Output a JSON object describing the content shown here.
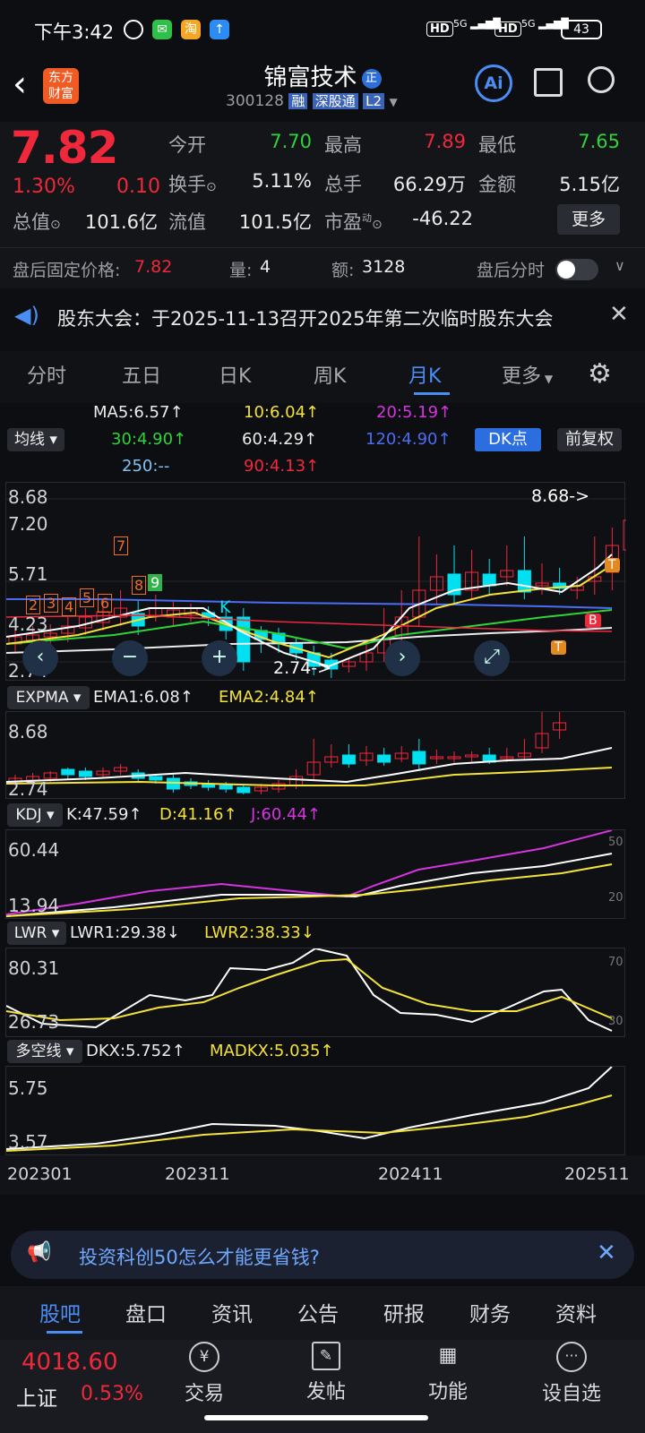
{
  "status": {
    "time": "下午3:42",
    "sig1": "HD",
    "sig2": "HD",
    "net1": "5G",
    "net2": "5G",
    "battery": "43"
  },
  "nav": {
    "logo": "东方财富",
    "title": "锦富技术",
    "badge": "正",
    "code": "300128",
    "tags": [
      "融",
      "深股通",
      "L2"
    ]
  },
  "quote": {
    "price": "7.82",
    "pct": "1.30%",
    "chg": "0.10",
    "rows": [
      [
        {
          "l": "今开",
          "v": "7.70",
          "c": "green"
        },
        {
          "l": "最高",
          "v": "7.89",
          "c": "red"
        },
        {
          "l": "最低",
          "v": "7.65",
          "c": "green"
        }
      ],
      [
        {
          "l": "换手",
          "v": "5.11%",
          "c": "white"
        },
        {
          "l": "总手",
          "v": "66.29万",
          "c": "white"
        },
        {
          "l": "金额",
          "v": "5.15亿",
          "c": "white"
        }
      ],
      [
        {
          "l": "总值",
          "v": "101.6亿",
          "c": "white"
        },
        {
          "l": "流值",
          "v": "101.5亿",
          "c": "white"
        },
        {
          "l": "市盈",
          "v": "-46.22",
          "c": "white"
        }
      ]
    ],
    "more": "更多",
    "pe_sup": "动"
  },
  "after": {
    "label": "盘后固定价格:",
    "price": "7.82",
    "vol_l": "量:",
    "vol": "4",
    "amt_l": "额:",
    "amt": "3128",
    "ts_l": "盘后分时"
  },
  "notice": {
    "text": "股东大会：于2025-11-13召开2025年第二次临时股东大会"
  },
  "tabs": [
    "分时",
    "五日",
    "日K",
    "周K",
    "月K",
    "更多"
  ],
  "ma": {
    "sel": "均线",
    "ma5": "MA5:6.57↑",
    "ma10": "10:6.04↑",
    "ma20": "20:5.19↑",
    "ma30": "30:4.90↑",
    "ma60": "60:4.29↑",
    "ma120": "120:4.90↑",
    "ma250": "250:--",
    "ma90": "90:4.13↑",
    "dk": "DK点",
    "fq": "前复权"
  },
  "main": {
    "yticks": [
      "8.68",
      "7.20",
      "5.71",
      "4.23",
      "2.74"
    ],
    "hi_label": "8.68->",
    "lo_label": "2.74->",
    "k": "K",
    "marks": [
      "2",
      "3",
      "4",
      "5",
      "6",
      "7",
      "8",
      "9"
    ],
    "tmark": "T",
    "bmark": "B"
  },
  "expma": {
    "sel": "EXPMA",
    "e1": "EMA1:6.08↑",
    "e2": "EMA2:4.84↑",
    "yticks": [
      "8.68",
      "2.74"
    ]
  },
  "kdj": {
    "sel": "KDJ",
    "k": "K:47.59↑",
    "d": "D:41.16↑",
    "j": "J:60.44↑",
    "yticks": [
      "60.44",
      "13.94"
    ],
    "r": [
      "50",
      "20"
    ]
  },
  "lwr": {
    "sel": "LWR",
    "l1": "LWR1:29.38↓",
    "l2": "LWR2:38.33↓",
    "yticks": [
      "80.31",
      "26.73"
    ],
    "r": [
      "70",
      "30"
    ]
  },
  "dkx": {
    "sel": "多空线",
    "dkx": "DKX:5.752↑",
    "mad": "MADKX:5.035↑",
    "yticks": [
      "5.75",
      "3.57"
    ]
  },
  "xaxis": [
    "202301",
    "202311",
    "202411",
    "202511"
  ],
  "ad": {
    "text": "投资科创50怎么才能更省钱?"
  },
  "bottomtabs": [
    "股吧",
    "盘口",
    "资讯",
    "公告",
    "研报",
    "财务",
    "资料"
  ],
  "toolbar": {
    "index": "4018.60",
    "index_name": "上证",
    "index_pct": "0.53%",
    "items": [
      "交易",
      "发帖",
      "功能",
      "设自选"
    ]
  }
}
